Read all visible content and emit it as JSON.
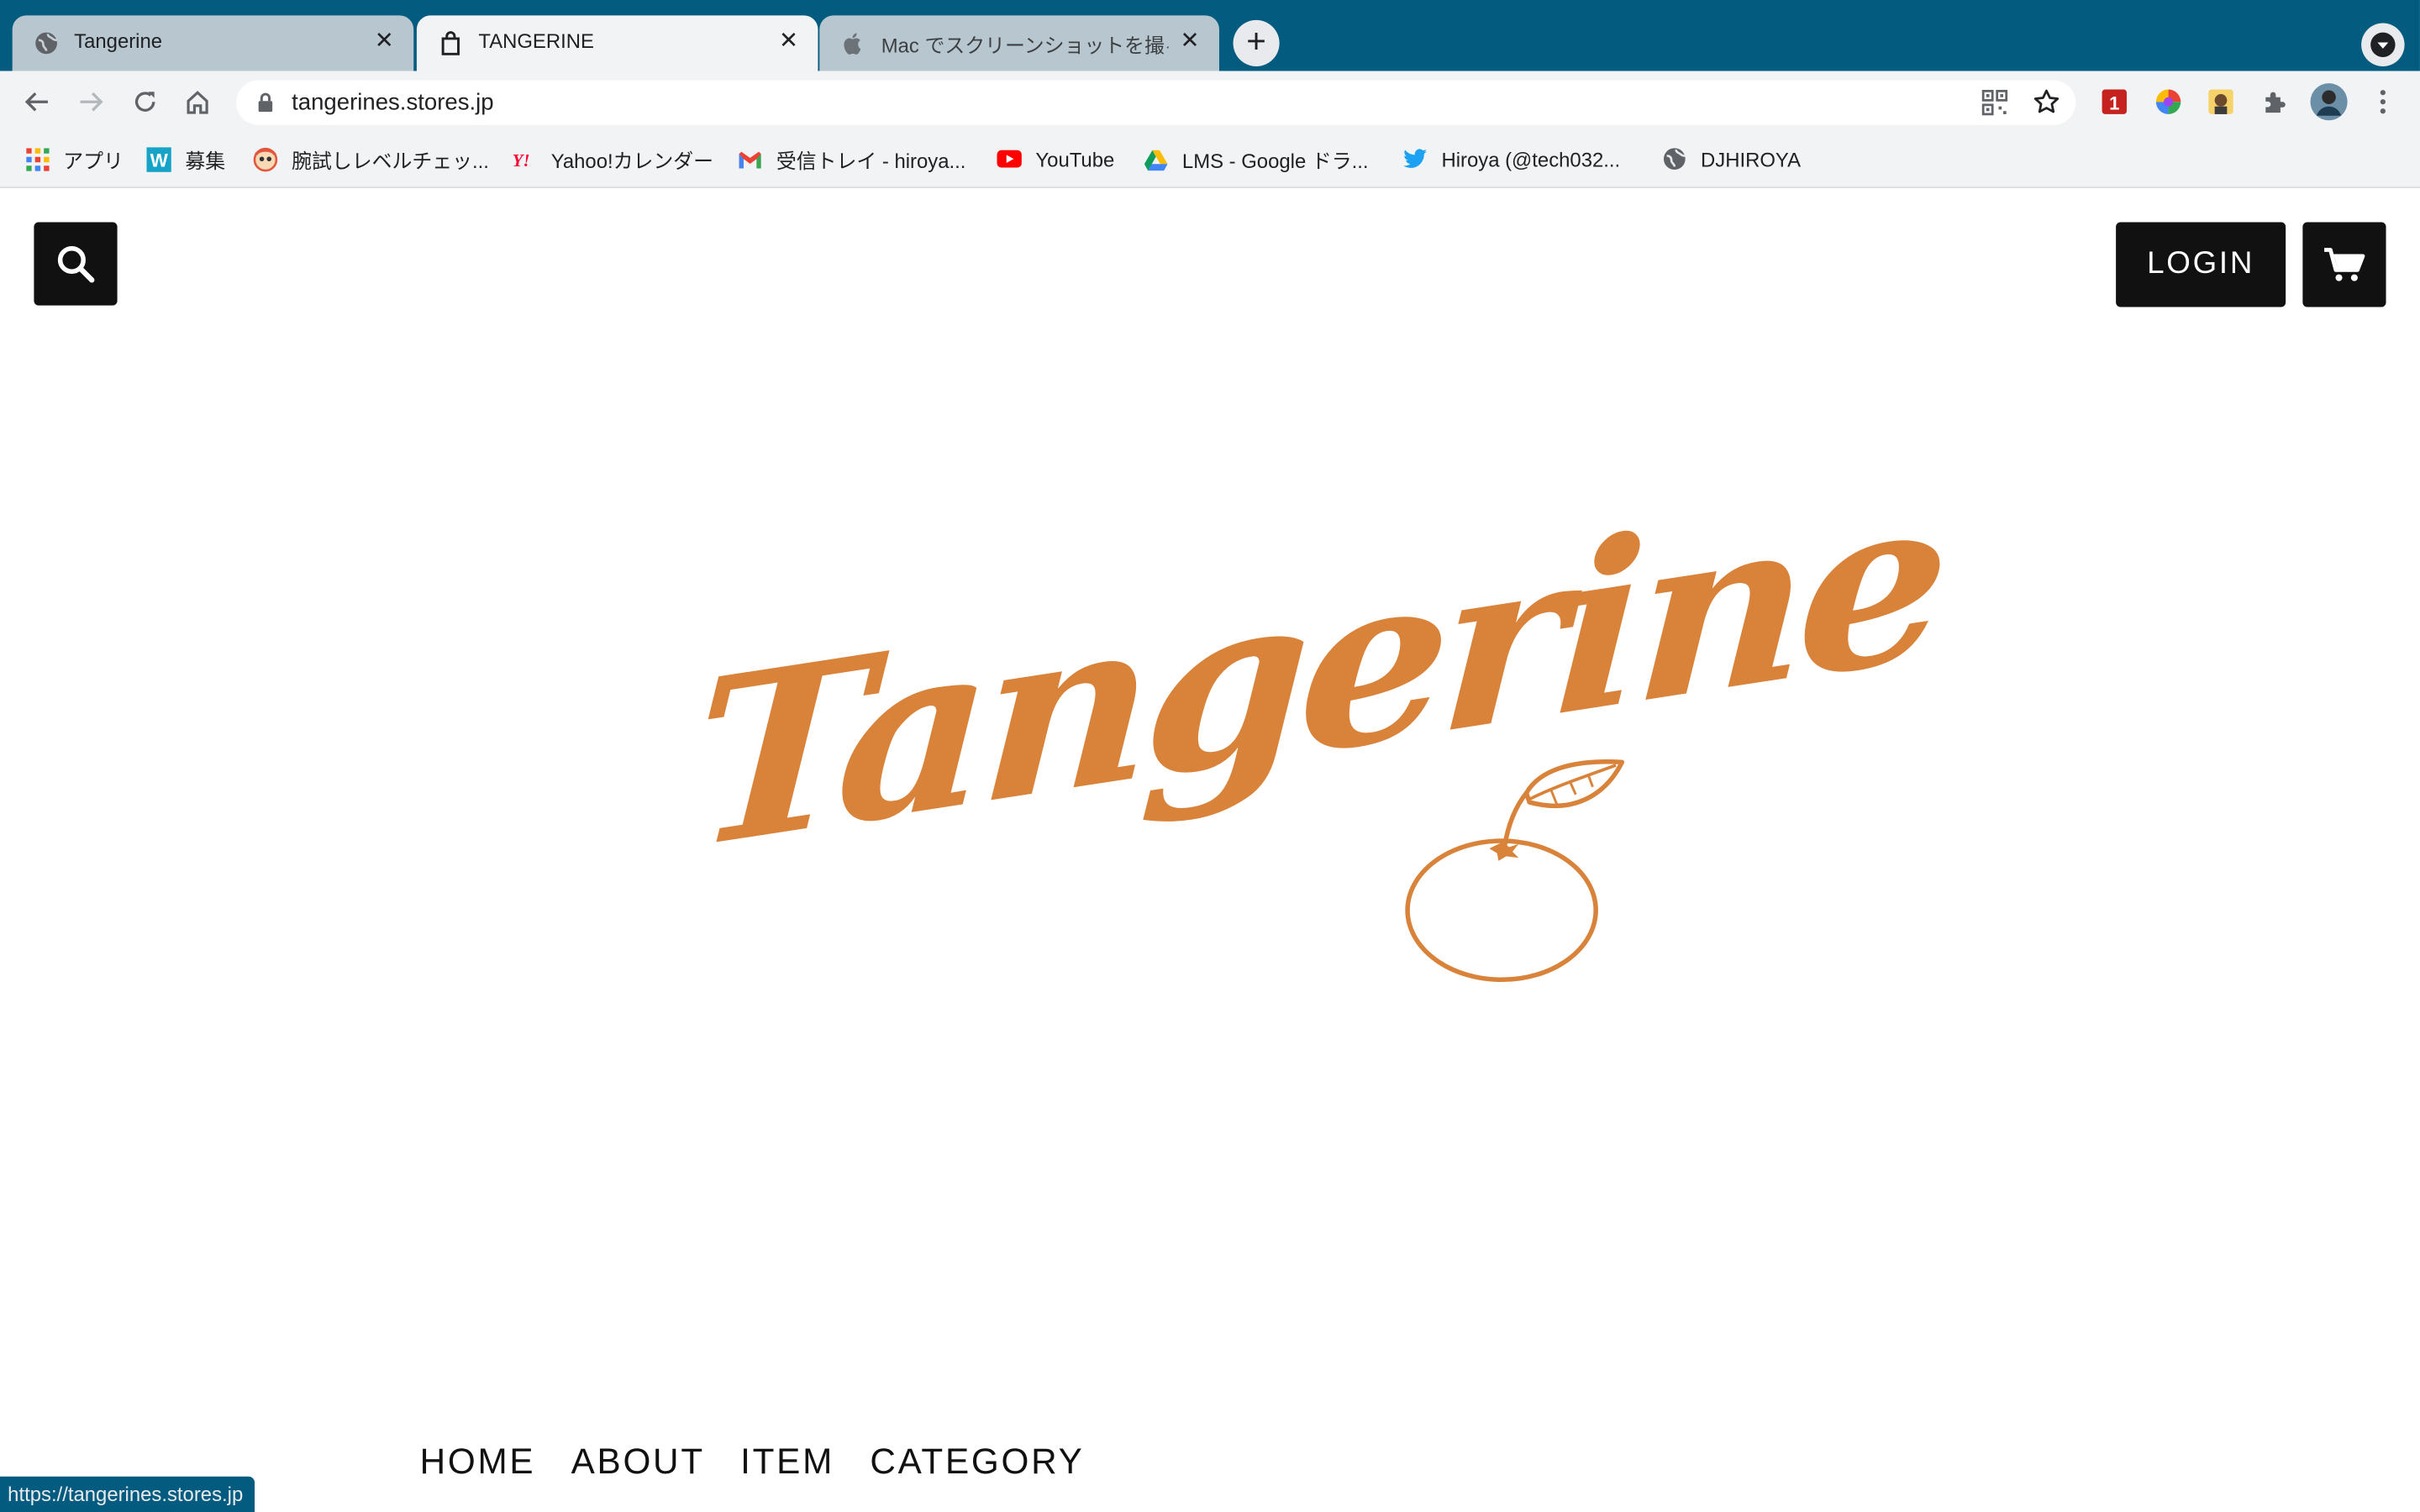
{
  "browser": {
    "tabs": [
      {
        "title": "Tangerine",
        "icon": "globe-icon"
      },
      {
        "title": "TANGERINE",
        "icon": "store-bag-icon"
      },
      {
        "title": "Mac でスクリーンショットを撮る",
        "icon": "apple-icon"
      }
    ],
    "close_glyph": "✕",
    "new_tab_glyph": "+",
    "url": "tangerines.stores.jp",
    "status_url": "https://tangerines.stores.jp"
  },
  "bookmarks": [
    {
      "label": "アプリ",
      "icon": "apps-grid-icon"
    },
    {
      "label": "募集",
      "icon": "w-logo-icon"
    },
    {
      "label": "腕試しレベルチェッ...",
      "icon": "face-icon"
    },
    {
      "label": "Yahoo!カレンダー",
      "icon": "yahoo-icon"
    },
    {
      "label": "受信トレイ - hiroya...",
      "icon": "gmail-icon"
    },
    {
      "label": "YouTube",
      "icon": "youtube-icon"
    },
    {
      "label": "LMS - Google ドラ...",
      "icon": "google-drive-icon"
    },
    {
      "label": "Hiroya (@tech032...",
      "icon": "twitter-icon"
    },
    {
      "label": "DJHIROYA",
      "icon": "globe-icon"
    }
  ],
  "site": {
    "login_label": "LOGIN",
    "logo_text": "Tangerine",
    "nav": [
      "HOME",
      "ABOUT",
      "ITEM",
      "CATEGORY"
    ],
    "brand_color": "#d9833a"
  },
  "colors": {
    "tabstrip": "#035c80",
    "toolbar": "#f1f3f4",
    "button_dark": "#111111"
  }
}
